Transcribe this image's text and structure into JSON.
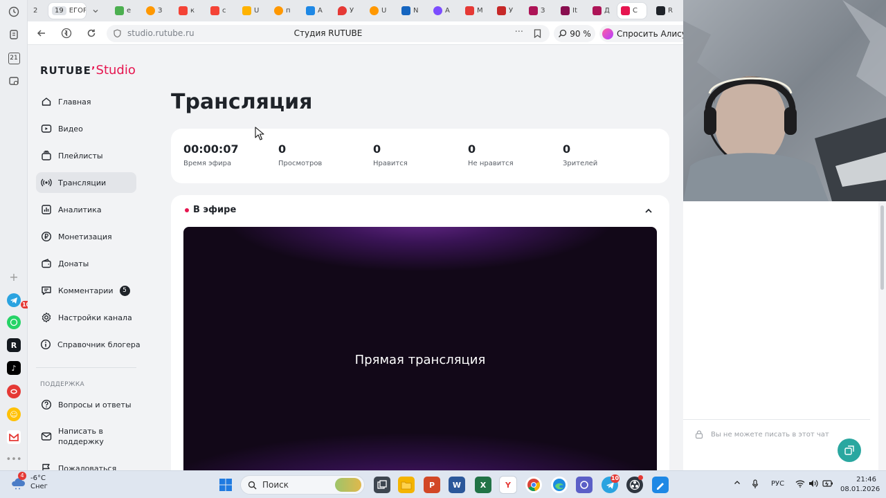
{
  "browser": {
    "tabs": [
      {
        "label": "2",
        "color": "#dfe2e6"
      },
      {
        "label": "ЕГОР",
        "count": "19",
        "active": true,
        "color": "#ffffff"
      },
      {
        "label": "е",
        "color": "#4caf50"
      },
      {
        "label": "З",
        "color": "#ff9800"
      },
      {
        "label": "к",
        "color": "#f44336"
      },
      {
        "label": "с",
        "color": "#f44336"
      },
      {
        "label": "U",
        "color": "#ffb300"
      },
      {
        "label": "п",
        "color": "#ff9800"
      },
      {
        "label": "А",
        "color": "#1e88e5"
      },
      {
        "label": "У",
        "color": "#e53935"
      },
      {
        "label": "U",
        "color": "#ff9800"
      },
      {
        "label": "N",
        "color": "#1565c0"
      },
      {
        "label": "А",
        "color": "#7c4dff"
      },
      {
        "label": "М",
        "color": "#e53935"
      },
      {
        "label": "У",
        "color": "#c62828"
      },
      {
        "label": "З",
        "color": "#ad1457"
      },
      {
        "label": "It",
        "color": "#880e4f"
      },
      {
        "label": "Д",
        "color": "#ad1457"
      },
      {
        "label": "С",
        "color": "#e6154f",
        "active": true
      },
      {
        "label": "R",
        "color": "#1f2329"
      }
    ],
    "url": "studio.rutube.ru",
    "page_title": "Студия RUTUBE",
    "zoom": "90 %",
    "alice": "Спросить Алису А"
  },
  "left_strip": {
    "date_badge": "21",
    "telegram_badge": "10"
  },
  "studio": {
    "logo_main": "RUTUBE",
    "logo_studio": "Studio",
    "nav": [
      {
        "label": "Главная",
        "icon": "home-icon"
      },
      {
        "label": "Видео",
        "icon": "video-icon"
      },
      {
        "label": "Плейлисты",
        "icon": "playlist-icon"
      },
      {
        "label": "Трансляции",
        "icon": "broadcast-icon",
        "active": true
      },
      {
        "label": "Аналитика",
        "icon": "analytics-icon"
      },
      {
        "label": "Монетизация",
        "icon": "ruble-icon"
      },
      {
        "label": "Донаты",
        "icon": "wallet-icon"
      },
      {
        "label": "Комментарии",
        "icon": "comment-icon",
        "badge": "5"
      },
      {
        "label": "Настройки канала",
        "icon": "gear-icon"
      },
      {
        "label": "Справочник блогера",
        "icon": "info-icon"
      }
    ],
    "support_label": "ПОДДЕРЖКА",
    "support": [
      {
        "label": "Вопросы и ответы",
        "icon": "question-icon"
      },
      {
        "label": "Написать в поддержку",
        "icon": "mail-icon"
      },
      {
        "label": "Пожаловаться",
        "icon": "flag-icon"
      }
    ],
    "title": "Трансляция",
    "stats": [
      {
        "value": "00:00:07",
        "label": "Время эфира"
      },
      {
        "value": "0",
        "label": "Просмотров"
      },
      {
        "value": "0",
        "label": "Нравится"
      },
      {
        "value": "0",
        "label": "Не нравится"
      },
      {
        "value": "0",
        "label": "Зрителей"
      }
    ],
    "live_label": "В эфире",
    "player_title": "Прямая трансляция"
  },
  "chat": {
    "disabled_note": "Вы не можете писать в этот чат"
  },
  "taskbar": {
    "temperature": "-6°C",
    "weather": "Снег",
    "weather_badge": "4",
    "search": "Поиск",
    "telegram_badge": "10",
    "lang": "РУС",
    "time": "21:46",
    "date": "08.01.2026"
  }
}
